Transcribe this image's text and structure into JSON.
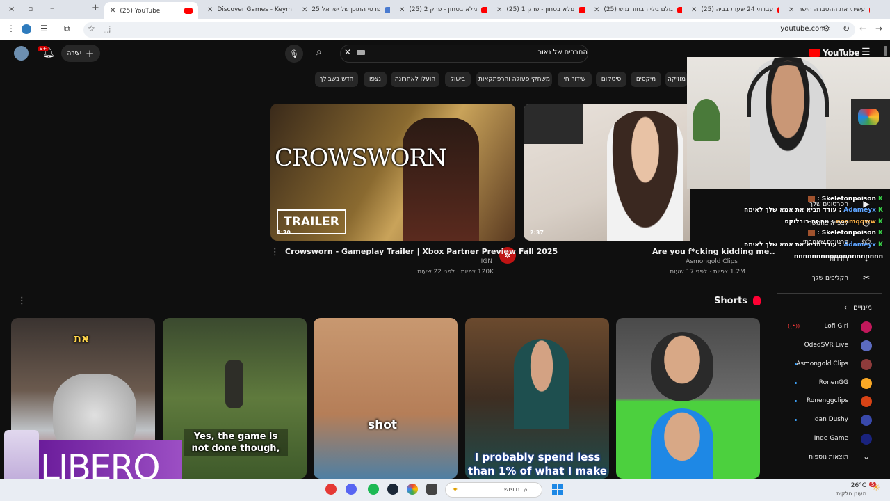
{
  "browser": {
    "tabs": [
      {
        "label": "(25) YouTube",
        "active": true
      },
      {
        "label": "Discover Games - Keyma"
      },
      {
        "label": "פרסי התוכן של ישראל 25"
      },
      {
        "label": "(25) מלא בטחון - פרק 2"
      },
      {
        "label": "(25) מלא בטחון - פרק 1"
      },
      {
        "label": "(25) גולם גילי הבחור מוש"
      },
      {
        "label": "(25) עבדתי 24 שעות בביה"
      },
      {
        "label": "עשיתי את ההסברה הישר"
      }
    ],
    "url": "youtube.com"
  },
  "youtube": {
    "create_label": "יצירה",
    "notification_count": "9+",
    "search_value": "החברים של נאור",
    "logo": "YouTube",
    "chips": [
      "חדש בשבילך",
      "נצפו",
      "הועלו לאחרונה",
      "בישול",
      "משחקי פעולה והרפתקאות",
      "שידור חי",
      "סיטקום",
      "מיקסים",
      "מוזיקה"
    ],
    "videos": [
      {
        "title": "Crowsworn - Gameplay Trailer | Xbox Partner Preview Fall 2025",
        "channel": "IGN",
        "meta": "120K צפיות · לפני 22 שעות",
        "duration": "1:30",
        "thumb_title": "CROWSWORN",
        "thumb_badge": "TRAILER"
      },
      {
        "title": "Are you f*cking kidding me..",
        "channel": "Asmongold Clips",
        "meta": "1.2M צפיות · לפני 17 שעות",
        "duration": "2:37"
      }
    ],
    "shorts_label": "Shorts",
    "shorts": [
      {
        "caption": "",
        "overlay": "את"
      },
      {
        "caption": "Yes, the game is not done though,"
      },
      {
        "caption": "shot"
      },
      {
        "caption": "I probably spend less than 1% of what I make"
      },
      {
        "caption": ""
      }
    ],
    "sidebar": {
      "items": [
        {
          "label": "הסרטונים שלך",
          "icon": "play-icon"
        },
        {
          "label": "לצפייה בהמשך",
          "icon": "clock-icon"
        },
        {
          "label": "סרטונים שאהבתי",
          "icon": "like-icon"
        },
        {
          "label": "הורדות",
          "icon": "download-icon"
        },
        {
          "label": "הקליפים שלך",
          "icon": "scissors-icon"
        }
      ],
      "subs_header": "מינויים",
      "subscriptions": [
        {
          "name": "Lofi Girl",
          "color": "#c2185b"
        },
        {
          "name": "OdedSVR Live",
          "color": "#5c6bc0"
        },
        {
          "name": "Asmongold Clips",
          "color": "#8e3b3b"
        },
        {
          "name": "RonenGG",
          "color": "#f9a825"
        },
        {
          "name": "Ronenggclips",
          "color": "#d84315"
        },
        {
          "name": "Idan Dushy",
          "color": "#3949ab"
        },
        {
          "name": "Inde Game",
          "color": "#1a237e"
        }
      ],
      "show_more": "תוצאות נוספות"
    }
  },
  "stream_chat": [
    {
      "user": "Skeletonpoison",
      "text": "",
      "color": "#ffffff"
    },
    {
      "user": "Adameyx",
      "text": "עודד תביא את אמא שלך לאימה",
      "color": "#5ea4ff"
    },
    {
      "user": "noamqqww",
      "text": "מה זה רובלוקס",
      "color": "#ffb347"
    },
    {
      "user": "Skeletonpoison",
      "text": "",
      "color": "#ffffff"
    },
    {
      "user": "Adameyx",
      "text": "עודד תביא את אמא שלך לאימה",
      "color": "#5ea4ff"
    },
    {
      "user": "",
      "text": "nnnnnnnnnnnnnnnnnnnn",
      "color": "#ffffff"
    }
  ],
  "overlay_logo": "LIBERO",
  "taskbar": {
    "search_placeholder": "חיפוש",
    "weather_temp": "26°C",
    "weather_desc": "מעונן חלקית",
    "notification_badge": "5"
  }
}
